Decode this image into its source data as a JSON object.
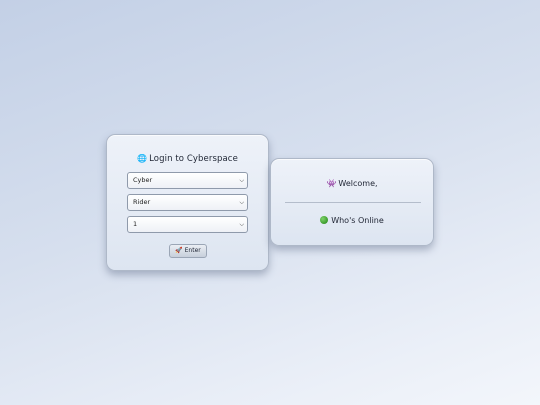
{
  "login": {
    "globe_icon": "🌐",
    "title": "Login to Cyberspace",
    "selects": [
      {
        "value": "Cyber"
      },
      {
        "value": "Rider"
      },
      {
        "value": "1"
      }
    ],
    "enter_icon": "🚀",
    "enter_label": "Enter"
  },
  "info": {
    "alien_icon": "👾",
    "welcome_text": "Welcome,",
    "online_text": "Who's Online",
    "online_color": "#3a9a2c"
  }
}
